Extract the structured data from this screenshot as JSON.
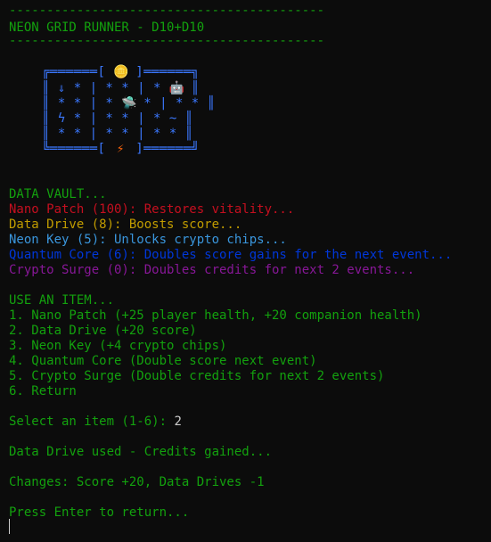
{
  "colors": {
    "background": "#0c0c0c",
    "green": "#13a10e",
    "red": "#c50f1f",
    "yellow": "#c19c00",
    "cyan": "#3a96dd",
    "blue": "#0037da",
    "purple": "#881798",
    "white": "#cccccc",
    "ascii_border": "#3b78ff"
  },
  "header": {
    "rule_top": "------------------------------------------",
    "title": "NEON GRID RUNNER - D10+D10",
    "rule_bottom": "------------------------------------------"
  },
  "grid_art": {
    "row0": "╔══════[ ",
    "row0_icon": "coin-icon",
    "row0_end": " ]══════╗",
    "row1": "║ ⇓ * | * * | * ",
    "row1_icon": "robot-icon",
    "row1_end": " ║",
    "row2": "║ * * | * ",
    "row2_icon": "ufo-icon",
    "row2_end": " * | * * ║",
    "row3": "║ ϟ * | * * | * ~ ║",
    "row4": "║ * * | * * | * * ║",
    "row5": "╚══════[ ",
    "row5_icon": "lightning-icon",
    "row5_end": " ]══════╝"
  },
  "vault": {
    "title": "DATA VAULT...",
    "items": [
      {
        "text": "Nano Patch (100): Restores vitality...",
        "color": "#c50f1f"
      },
      {
        "text": "Data Drive (8): Boosts score...",
        "color": "#c19c00"
      },
      {
        "text": "Neon Key (5): Unlocks crypto chips...",
        "color": "#3a96dd"
      },
      {
        "text": "Quantum Core (6): Doubles score gains for the next event...",
        "color": "#0037da"
      },
      {
        "text": "Crypto Surge (0): Doubles credits for next 2 events...",
        "color": "#881798"
      }
    ]
  },
  "menu": {
    "title": "USE AN ITEM...",
    "options": [
      "1. Nano Patch (+25 player health, +20 companion health)",
      "2. Data Drive (+20 score)",
      "3. Neon Key (+4 crypto chips)",
      "4. Quantum Core (Double score next event)",
      "5. Crypto Surge (Double credits for next 2 events)",
      "6. Return"
    ]
  },
  "prompt": {
    "label": "Select an item (1-6): ",
    "input": "2"
  },
  "result": {
    "used": "Data Drive used - Credits gained...",
    "changes": "Changes: Score +20, Data Drives -1",
    "continue": "Press Enter to return..."
  }
}
